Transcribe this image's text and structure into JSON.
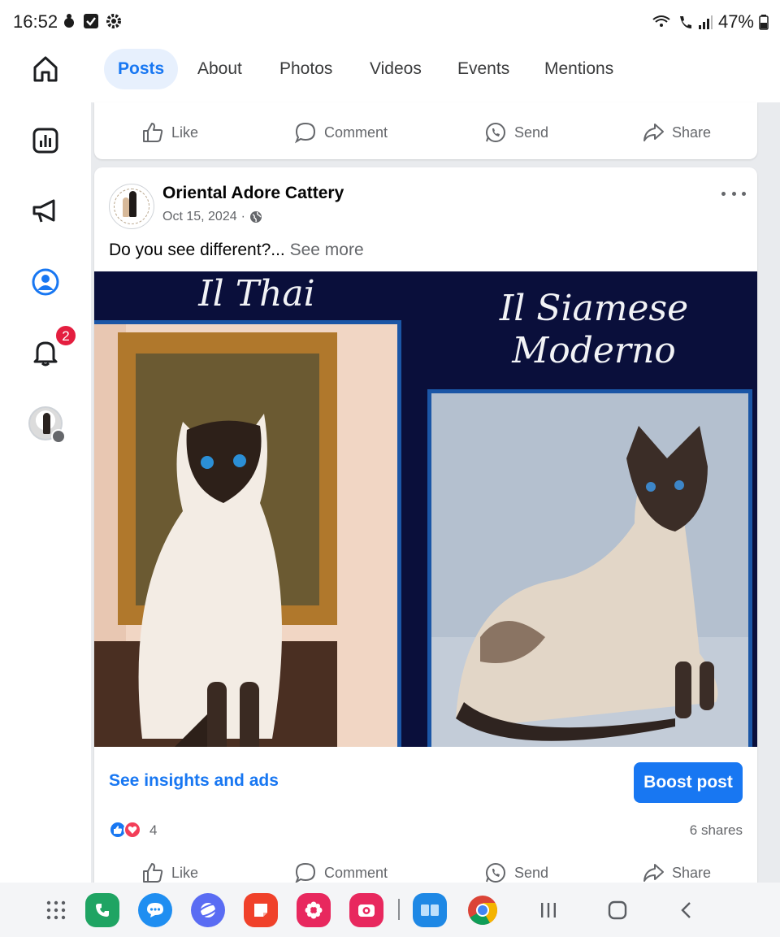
{
  "status_bar": {
    "time": "16:52",
    "battery": "47%"
  },
  "left_rail": {
    "items": [
      {
        "name": "home",
        "icon": "home-icon"
      },
      {
        "name": "insights",
        "icon": "chart-icon"
      },
      {
        "name": "ads",
        "icon": "megaphone-icon"
      },
      {
        "name": "profile",
        "icon": "profile-icon"
      },
      {
        "name": "notifications",
        "icon": "bell-icon",
        "badge": "2"
      },
      {
        "name": "account",
        "icon": "avatar"
      }
    ]
  },
  "tabs": [
    {
      "label": "Posts",
      "active": true
    },
    {
      "label": "About",
      "active": false
    },
    {
      "label": "Photos",
      "active": false
    },
    {
      "label": "Videos",
      "active": false
    },
    {
      "label": "Events",
      "active": false
    },
    {
      "label": "Mentions",
      "active": false
    }
  ],
  "actions": {
    "like": "Like",
    "comment": "Comment",
    "send": "Send",
    "share": "Share"
  },
  "post": {
    "author": "Oriental Adore Cattery",
    "date": "Oct 15, 2024",
    "separator": "·",
    "text": "Do you see different?...",
    "see_more": "See more",
    "image": {
      "title_left": "Il Thai",
      "title_right": "Il Siamese Moderno"
    },
    "insights_link": "See insights and ads",
    "boost_button": "Boost post",
    "reaction_count": "4",
    "shares": "6 shares"
  },
  "colors": {
    "accent": "#1877f2",
    "badge": "#e41e3f",
    "muted_text": "#65676b",
    "image_bg": "#0a0f3b"
  }
}
